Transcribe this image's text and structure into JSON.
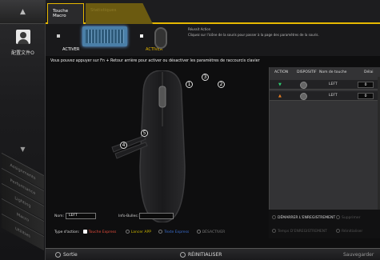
{
  "sidebar": {
    "profile_label": "配置文件O",
    "tabs": [
      "Assignments",
      "Performance",
      "Lighting",
      "Macro",
      "Utilities"
    ]
  },
  "tabs": {
    "active": "Touche Macro",
    "inactive": "Statistiques"
  },
  "header": {
    "activate_left": "ACTIVER",
    "activate_right": "ACTIVER",
    "desc_title": "Réussit Action",
    "desc_body": "Cliquez sur l'icône de la souris pour passer à la page des paramètres de la souris."
  },
  "instruction": "Vous pouvez appuyer sur Fn + Retour arrière pour activer ou désactiver les paramètres de raccourcis clavier",
  "mouse_numbers": [
    "1",
    "2",
    "3",
    "4",
    "5"
  ],
  "panel": {
    "headers": {
      "action": "ACTION",
      "device": "DISPOSITIF",
      "key": "Nom de touche",
      "delay": "Délai"
    },
    "rows": [
      {
        "arrow": "▼",
        "arrow_color": "#2ecc71",
        "key": "LEFT",
        "delay": "0"
      },
      {
        "arrow": "▲",
        "arrow_color": "#e67e22",
        "key": "LEFT",
        "delay": "0"
      }
    ]
  },
  "form": {
    "name_label": "Nom:",
    "name_value": "LEFT",
    "tooltip_label": "Info-Bulles:",
    "tooltip_value": "",
    "type_label": "Type d'action:",
    "types": [
      {
        "label": "Touche Express",
        "color": "#e74c3c"
      },
      {
        "label": "Lancer APP",
        "color": "#c9b400"
      },
      {
        "label": "Texte Express",
        "color": "#3b6fd1"
      },
      {
        "label": "DÉSACTIVER",
        "color": "#777"
      }
    ]
  },
  "right_actions": {
    "start_record": "DÉMARRER L'ENREGISTREMENT",
    "delete": "Supprimer",
    "record_time": "Temps D'ENREGISTREMENT",
    "reset": "Réinitialiser"
  },
  "footer": {
    "exit": "Sortie",
    "reset": "RÉINITIALISER",
    "save": "Sauvegarder"
  },
  "colors": {
    "accent": "#e6b800"
  }
}
